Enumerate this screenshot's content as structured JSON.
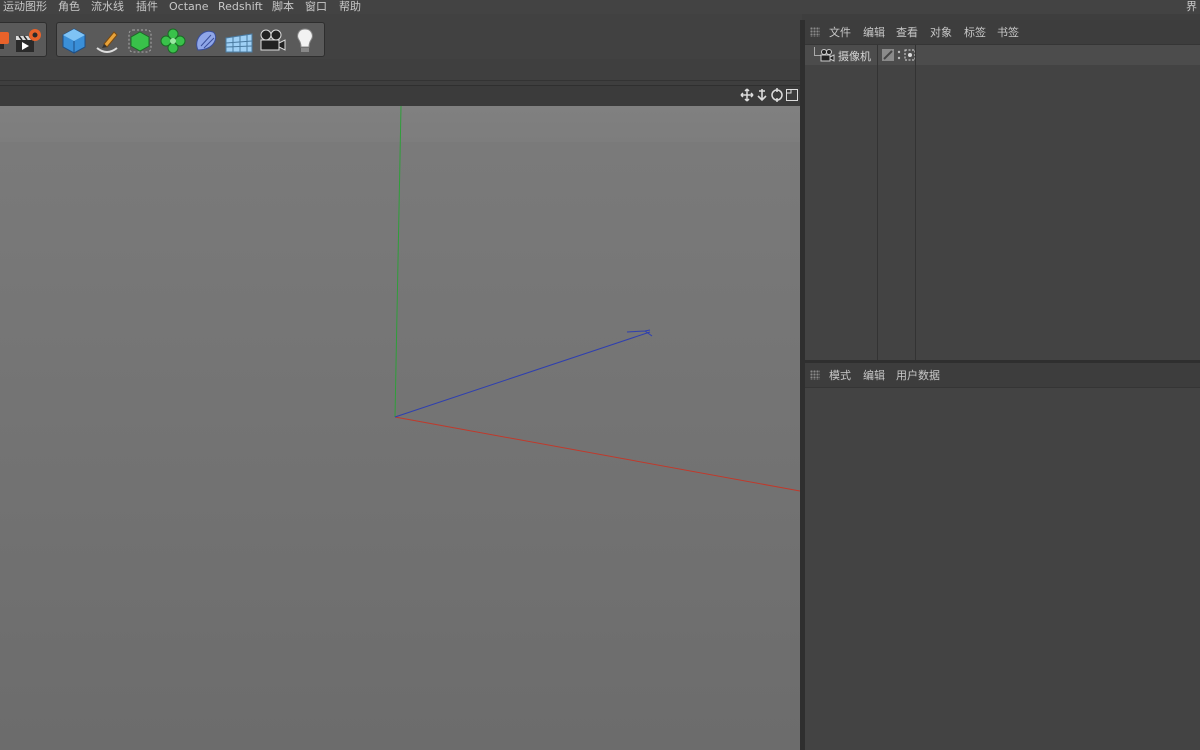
{
  "menubar": {
    "items": [
      "运动图形",
      "角色",
      "流水线",
      "插件",
      "Octane",
      "Redshift",
      "脚本",
      "窗口",
      "帮助"
    ],
    "right_label": "界"
  },
  "toolbar": {
    "tools": [
      "render-settings-icon",
      "render-to-picture-viewer-icon",
      "cube-icon",
      "pen-icon",
      "subdivision-icon",
      "cloner-icon",
      "deformer-icon",
      "floor-icon",
      "camera-icon",
      "light-icon"
    ]
  },
  "object_manager": {
    "menu": [
      "文件",
      "编辑",
      "查看",
      "对象",
      "标签",
      "书签"
    ],
    "object_name": "摄像机"
  },
  "attribute_manager": {
    "menu": [
      "模式",
      "编辑",
      "用户数据"
    ]
  },
  "colors": {
    "axis_y": "#2f9e3a",
    "axis_x": "#c0392b",
    "axis_z": "#2e3fb0",
    "panel_bg": "#434343",
    "viewport_top": "#808080",
    "viewport_bottom": "#6c6c6c"
  }
}
